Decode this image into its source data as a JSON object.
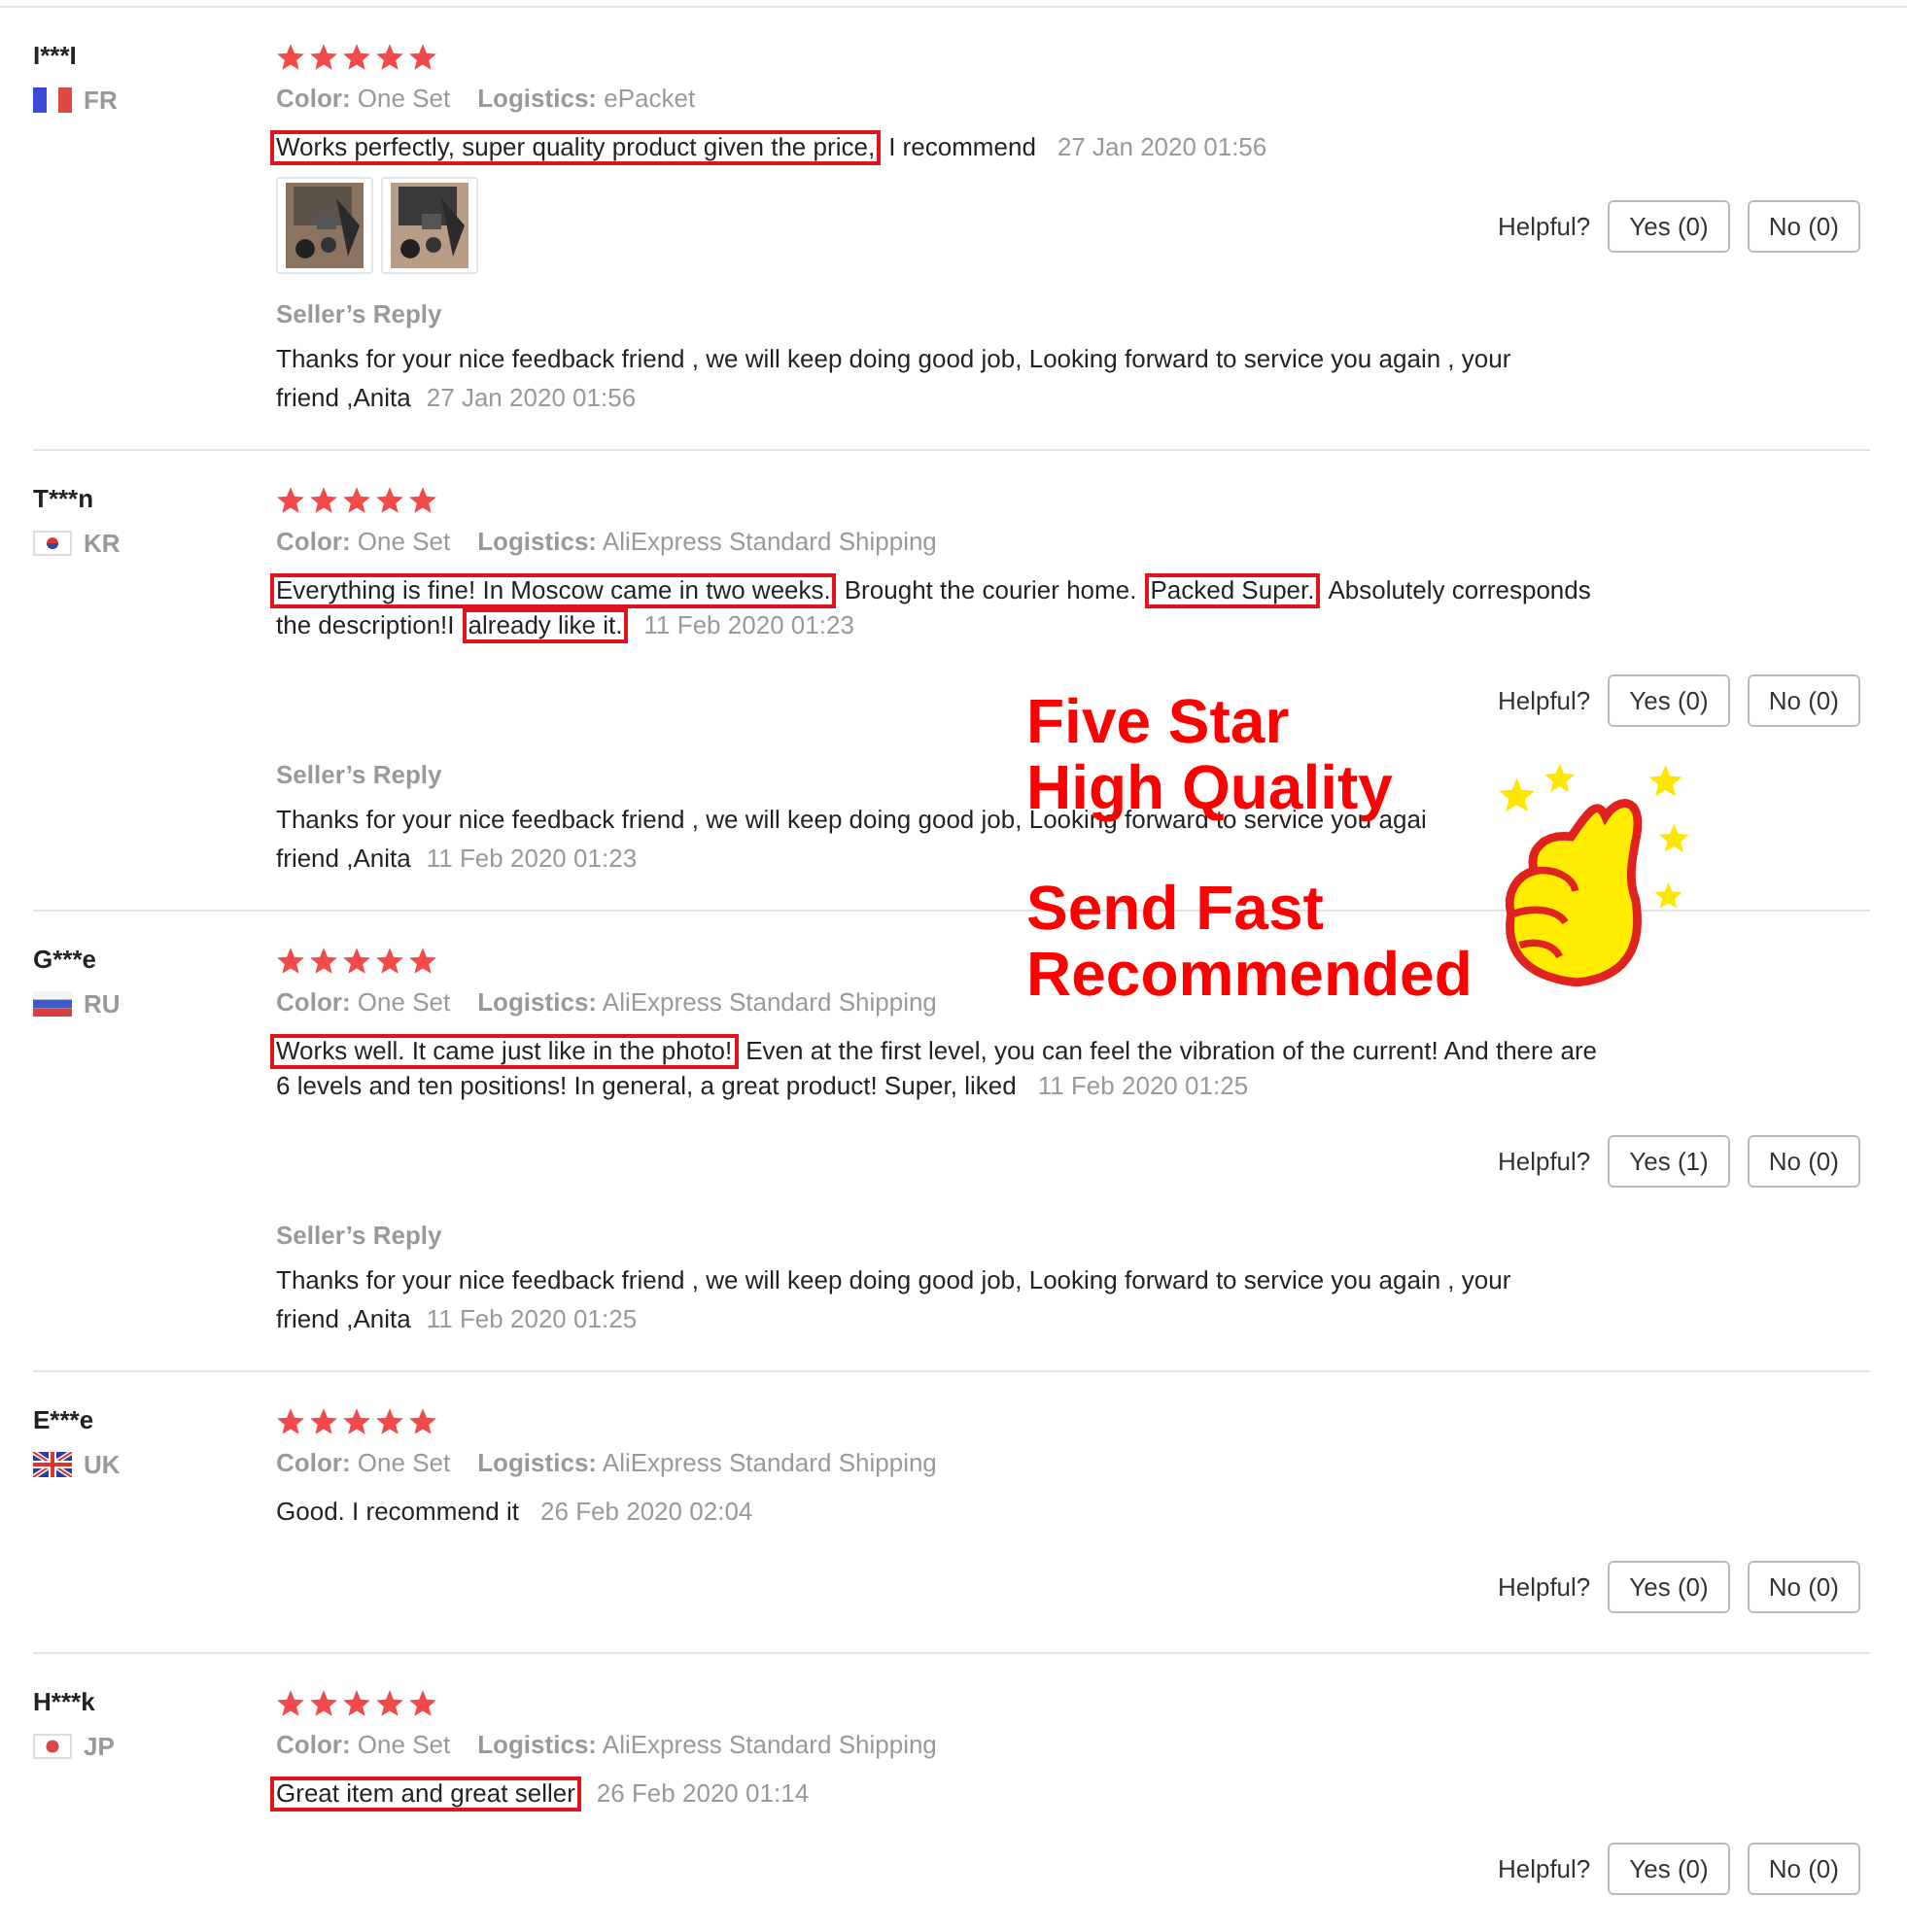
{
  "reviews": [
    {
      "user": "I***I",
      "flag": {
        "kind": "fr"
      },
      "country": "FR",
      "stars": 5,
      "color_label": "Color:",
      "color_option": "One Set",
      "logistics_label": "Logistics:",
      "logistics": "ePacket",
      "body": [
        [
          {
            "text": "Works perfectly, super quality product given the price,",
            "boxed": true
          },
          {
            "text": "I recommend",
            "boxed": false
          }
        ]
      ],
      "date": "27 Jan 2020 01:56",
      "photos": [
        {
          "kind": "picture"
        },
        {
          "kind": "picture"
        }
      ],
      "helpful_label": "Helpful?",
      "buttons": [
        "Yes (0)",
        "No (0)"
      ],
      "reply": {
        "label": "Seller’s Reply",
        "lines": [
          "Thanks for your nice feedback friend , we will keep doing good job, Looking forward to service you again , your",
          "friend ,Anita"
        ],
        "date": "27 Jan 2020 01:56"
      }
    },
    {
      "user": "T***n",
      "flag": {
        "kind": "kr"
      },
      "country": "KR",
      "stars": 5,
      "color_label": "Color:",
      "color_option": "One Set",
      "logistics_label": "Logistics:",
      "logistics": "AliExpress Standard Shipping",
      "body": [
        [
          {
            "text": "Everything is fine! In Moscow came in two weeks.",
            "boxed": true
          },
          {
            "text": "Brought the courier home.",
            "boxed": false
          },
          {
            "text": "Packed Super.",
            "boxed": true
          },
          {
            "text": "Absolutely corresponds",
            "boxed": false
          }
        ],
        [
          {
            "text": "the description!I",
            "boxed": false
          },
          {
            "text": "already like it.",
            "boxed": true
          }
        ]
      ],
      "date": "11 Feb 2020 01:23",
      "helpful_label": "Helpful?",
      "buttons": [
        "Yes (0)",
        "No (0)"
      ],
      "reply": {
        "label": "Seller’s Reply",
        "lines": [
          "Thanks for your nice feedback friend , we will keep doing good job, Looking forward to service you agai",
          "friend ,Anita"
        ],
        "date": "11 Feb 2020 01:23"
      }
    },
    {
      "user": "G***e",
      "flag": {
        "kind": "ru"
      },
      "country": "RU",
      "stars": 5,
      "color_label": "Color:",
      "color_option": "One Set",
      "logistics_label": "Logistics:",
      "logistics": "AliExpress Standard Shipping",
      "body": [
        [
          {
            "text": "Works well. It came just like in the photo!",
            "boxed": true
          },
          {
            "text": "Even at the first level, you can feel the vibration of the current! And there are",
            "boxed": false
          }
        ],
        [
          {
            "text": "6 levels and ten positions! In general, a great product! Super, liked",
            "boxed": false
          }
        ]
      ],
      "date": "11 Feb 2020 01:25",
      "helpful_label": "Helpful?",
      "buttons": [
        "Yes (1)",
        "No (0)"
      ],
      "reply": {
        "label": "Seller’s Reply",
        "lines": [
          "Thanks for your nice feedback friend , we will keep doing good job, Looking forward to service you again , your",
          "friend ,Anita"
        ],
        "date": "11 Feb 2020 01:25"
      }
    },
    {
      "user": "E***e",
      "flag": {
        "kind": "uk"
      },
      "country": "UK",
      "stars": 5,
      "color_label": "Color:",
      "color_option": "One Set",
      "logistics_label": "Logistics:",
      "logistics": "AliExpress Standard Shipping",
      "body": [
        [
          {
            "text": "Good. I recommend it",
            "boxed": false
          }
        ]
      ],
      "date": "26 Feb 2020 02:04",
      "helpful_label": "Helpful?",
      "buttons": [
        "Yes (0)",
        "No (0)"
      ]
    },
    {
      "user": "H***k",
      "flag": {
        "kind": "jp"
      },
      "country": "JP",
      "stars": 5,
      "color_label": "Color:",
      "color_option": "One Set",
      "logistics_label": "Logistics:",
      "logistics": "AliExpress Standard Shipping",
      "body": [
        [
          {
            "text": "Great item and great seller",
            "boxed": true
          }
        ]
      ],
      "date": "26 Feb 2020 01:14",
      "helpful_label": "Helpful?",
      "buttons": [
        "Yes (0)",
        "No (0)"
      ]
    }
  ],
  "promo": {
    "lines": [
      "Five Star",
      "High Quality",
      "Send Fast",
      "Recommended"
    ]
  }
}
